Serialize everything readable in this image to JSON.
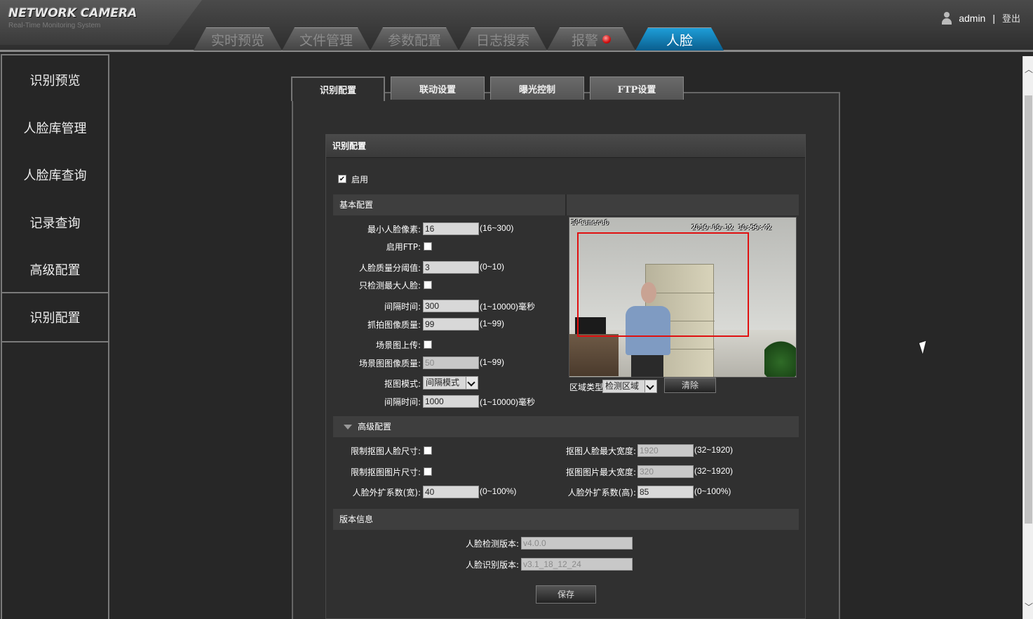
{
  "app": {
    "logo_title": "NETWORK CAMERA",
    "logo_subtitle": "Real-Time Monitoring System"
  },
  "nav": {
    "tabs": [
      {
        "label": "实时预览"
      },
      {
        "label": "文件管理"
      },
      {
        "label": "参数配置"
      },
      {
        "label": "日志搜索"
      },
      {
        "label": "报警"
      },
      {
        "label": "人脸",
        "active": true
      }
    ]
  },
  "user": {
    "name": "admin",
    "separator": "|",
    "logout": "登出"
  },
  "sidebar": {
    "items": [
      {
        "label": "识别预览"
      },
      {
        "label": "人脸库管理"
      },
      {
        "label": "人脸库查询"
      },
      {
        "label": "记录查询"
      },
      {
        "label": "高级配置"
      },
      {
        "label": "识别配置",
        "selected": true
      }
    ]
  },
  "subtabs": [
    {
      "label": "识别配置",
      "active": true
    },
    {
      "label": "联动设置"
    },
    {
      "label": "曝光控制"
    },
    {
      "label": "FTP设置"
    }
  ],
  "panel": {
    "title": "识别配置",
    "enable_label": "启用",
    "enable_checked": true,
    "basic": {
      "section_title": "基本配置",
      "min_face_px": {
        "label": "最小人脸像素:",
        "value": "16",
        "range": "(16~300)"
      },
      "enable_ftp": {
        "label": "启用FTP:",
        "checked": false
      },
      "quality_threshold": {
        "label": "人脸质量分阈值:",
        "value": "3",
        "range": "(0~10)"
      },
      "detect_max_face": {
        "label": "只检测最大人脸:",
        "checked": false
      },
      "interval": {
        "label": "间隔时间:",
        "value": "300",
        "range": "(1~10000)毫秒"
      },
      "capture_quality": {
        "label": "抓拍图像质量:",
        "value": "99",
        "range": "(1~99)"
      },
      "scene_upload": {
        "label": "场景图上传:",
        "checked": false
      },
      "scene_quality": {
        "label": "场景图图像质量:",
        "value": "50",
        "range": "(1~99)"
      },
      "capture_mode": {
        "label": "抠图模式:",
        "value": "间隔模式"
      },
      "interval2": {
        "label": "间隔时间:",
        "value": "1000",
        "range": "(1~10000)毫秒"
      }
    },
    "preview": {
      "osd_camera": "IPCamera0",
      "osd_time": "2019-09-12 10:59:42",
      "region_type_label": "区域类型",
      "region_type_value": "检测区域",
      "clear_button": "清除"
    },
    "advanced": {
      "section_title": "高级配置",
      "limit_face_size": {
        "label": "限制抠图人脸尺寸:",
        "checked": false
      },
      "limit_image_size": {
        "label": "限制抠图图片尺寸:",
        "checked": false
      },
      "expand_w": {
        "label": "人脸外扩系数(宽):",
        "value": "40",
        "range": "(0~100%)"
      },
      "face_max_width": {
        "label": "抠图人脸最大宽度:",
        "value": "1920",
        "range": "(32~1920)"
      },
      "image_max_width": {
        "label": "抠图图片最大宽度:",
        "value": "320",
        "range": "(32~1920)"
      },
      "expand_h": {
        "label": "人脸外扩系数(高):",
        "value": "85",
        "range": "(0~100%)"
      }
    },
    "version": {
      "section_title": "版本信息",
      "detect_version": {
        "label": "人脸检测版本:",
        "value": "v4.0.0"
      },
      "recog_version": {
        "label": "人脸识别版本:",
        "value": "v3.1_18_12_24"
      }
    },
    "save_button": "保存"
  }
}
